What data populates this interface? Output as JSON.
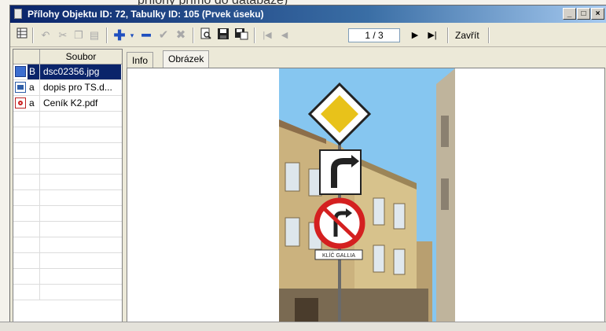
{
  "top_caption": "přílohy přímo do databáze)",
  "window": {
    "title": "Přílohy Objektu ID: 72, Tabulky ID: 105 (Prvek úseku)",
    "controls": [
      "_",
      "□",
      "×"
    ]
  },
  "toolbar": {
    "page_indicator": "1 / 3",
    "close_label": "Zavřít",
    "icons": [
      "grid-icon",
      "undo-icon",
      "cut-icon",
      "copy-icon",
      "paste-icon",
      "add-icon",
      "dropdown-icon",
      "remove-icon",
      "confirm-icon",
      "cancel-icon",
      "preview-icon",
      "save-icon",
      "save-as-icon",
      "first-icon",
      "prev-icon",
      "next-icon",
      "last-icon"
    ]
  },
  "file_list": {
    "header": "Soubor",
    "rows": [
      {
        "flag": "B",
        "name": "dsc02356.jpg",
        "selected": true,
        "icon": "image-file-icon"
      },
      {
        "flag": "a",
        "name": "dopis pro TS.d...",
        "selected": false,
        "icon": "doc-file-icon"
      },
      {
        "flag": "a",
        "name": "Ceník K2.pdf",
        "selected": false,
        "icon": "pdf-file-icon"
      }
    ]
  },
  "tabs": [
    {
      "label": "Info",
      "active": false
    },
    {
      "label": "Obrázek",
      "active": true
    }
  ],
  "photo": {
    "street_sign_text": "KLÍČ GALLIA"
  }
}
